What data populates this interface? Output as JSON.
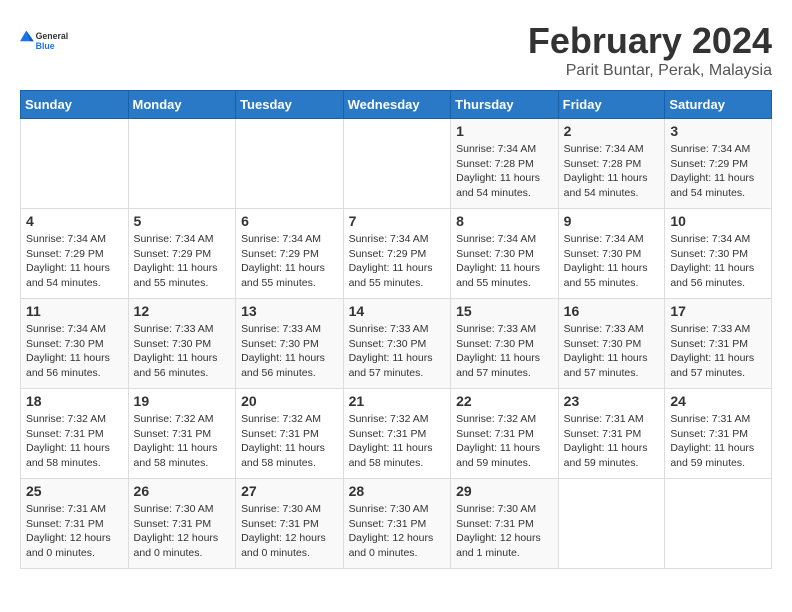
{
  "logo": {
    "general": "General",
    "blue": "Blue"
  },
  "title": "February 2024",
  "subtitle": "Parit Buntar, Perak, Malaysia",
  "days_of_week": [
    "Sunday",
    "Monday",
    "Tuesday",
    "Wednesday",
    "Thursday",
    "Friday",
    "Saturday"
  ],
  "weeks": [
    [
      {
        "day": "",
        "info": ""
      },
      {
        "day": "",
        "info": ""
      },
      {
        "day": "",
        "info": ""
      },
      {
        "day": "",
        "info": ""
      },
      {
        "day": "1",
        "info": "Sunrise: 7:34 AM\nSunset: 7:28 PM\nDaylight: 11 hours\nand 54 minutes."
      },
      {
        "day": "2",
        "info": "Sunrise: 7:34 AM\nSunset: 7:28 PM\nDaylight: 11 hours\nand 54 minutes."
      },
      {
        "day": "3",
        "info": "Sunrise: 7:34 AM\nSunset: 7:29 PM\nDaylight: 11 hours\nand 54 minutes."
      }
    ],
    [
      {
        "day": "4",
        "info": "Sunrise: 7:34 AM\nSunset: 7:29 PM\nDaylight: 11 hours\nand 54 minutes."
      },
      {
        "day": "5",
        "info": "Sunrise: 7:34 AM\nSunset: 7:29 PM\nDaylight: 11 hours\nand 55 minutes."
      },
      {
        "day": "6",
        "info": "Sunrise: 7:34 AM\nSunset: 7:29 PM\nDaylight: 11 hours\nand 55 minutes."
      },
      {
        "day": "7",
        "info": "Sunrise: 7:34 AM\nSunset: 7:29 PM\nDaylight: 11 hours\nand 55 minutes."
      },
      {
        "day": "8",
        "info": "Sunrise: 7:34 AM\nSunset: 7:30 PM\nDaylight: 11 hours\nand 55 minutes."
      },
      {
        "day": "9",
        "info": "Sunrise: 7:34 AM\nSunset: 7:30 PM\nDaylight: 11 hours\nand 55 minutes."
      },
      {
        "day": "10",
        "info": "Sunrise: 7:34 AM\nSunset: 7:30 PM\nDaylight: 11 hours\nand 56 minutes."
      }
    ],
    [
      {
        "day": "11",
        "info": "Sunrise: 7:34 AM\nSunset: 7:30 PM\nDaylight: 11 hours\nand 56 minutes."
      },
      {
        "day": "12",
        "info": "Sunrise: 7:33 AM\nSunset: 7:30 PM\nDaylight: 11 hours\nand 56 minutes."
      },
      {
        "day": "13",
        "info": "Sunrise: 7:33 AM\nSunset: 7:30 PM\nDaylight: 11 hours\nand 56 minutes."
      },
      {
        "day": "14",
        "info": "Sunrise: 7:33 AM\nSunset: 7:30 PM\nDaylight: 11 hours\nand 57 minutes."
      },
      {
        "day": "15",
        "info": "Sunrise: 7:33 AM\nSunset: 7:30 PM\nDaylight: 11 hours\nand 57 minutes."
      },
      {
        "day": "16",
        "info": "Sunrise: 7:33 AM\nSunset: 7:30 PM\nDaylight: 11 hours\nand 57 minutes."
      },
      {
        "day": "17",
        "info": "Sunrise: 7:33 AM\nSunset: 7:31 PM\nDaylight: 11 hours\nand 57 minutes."
      }
    ],
    [
      {
        "day": "18",
        "info": "Sunrise: 7:32 AM\nSunset: 7:31 PM\nDaylight: 11 hours\nand 58 minutes."
      },
      {
        "day": "19",
        "info": "Sunrise: 7:32 AM\nSunset: 7:31 PM\nDaylight: 11 hours\nand 58 minutes."
      },
      {
        "day": "20",
        "info": "Sunrise: 7:32 AM\nSunset: 7:31 PM\nDaylight: 11 hours\nand 58 minutes."
      },
      {
        "day": "21",
        "info": "Sunrise: 7:32 AM\nSunset: 7:31 PM\nDaylight: 11 hours\nand 58 minutes."
      },
      {
        "day": "22",
        "info": "Sunrise: 7:32 AM\nSunset: 7:31 PM\nDaylight: 11 hours\nand 59 minutes."
      },
      {
        "day": "23",
        "info": "Sunrise: 7:31 AM\nSunset: 7:31 PM\nDaylight: 11 hours\nand 59 minutes."
      },
      {
        "day": "24",
        "info": "Sunrise: 7:31 AM\nSunset: 7:31 PM\nDaylight: 11 hours\nand 59 minutes."
      }
    ],
    [
      {
        "day": "25",
        "info": "Sunrise: 7:31 AM\nSunset: 7:31 PM\nDaylight: 12 hours\nand 0 minutes."
      },
      {
        "day": "26",
        "info": "Sunrise: 7:30 AM\nSunset: 7:31 PM\nDaylight: 12 hours\nand 0 minutes."
      },
      {
        "day": "27",
        "info": "Sunrise: 7:30 AM\nSunset: 7:31 PM\nDaylight: 12 hours\nand 0 minutes."
      },
      {
        "day": "28",
        "info": "Sunrise: 7:30 AM\nSunset: 7:31 PM\nDaylight: 12 hours\nand 0 minutes."
      },
      {
        "day": "29",
        "info": "Sunrise: 7:30 AM\nSunset: 7:31 PM\nDaylight: 12 hours\nand 1 minute."
      },
      {
        "day": "",
        "info": ""
      },
      {
        "day": "",
        "info": ""
      }
    ]
  ]
}
